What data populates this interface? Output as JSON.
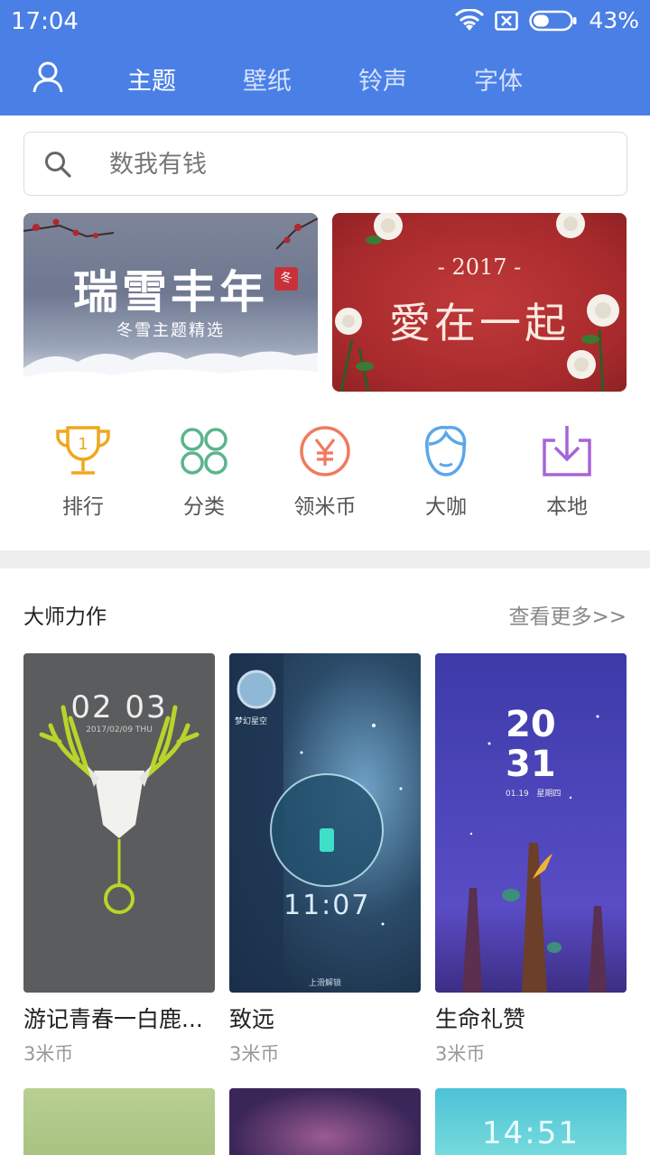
{
  "status_bar": {
    "time": "17:04",
    "battery_percent": "43%",
    "battery_level": 0.43
  },
  "tabs": [
    {
      "label": "主题",
      "active": true
    },
    {
      "label": "壁纸",
      "active": false
    },
    {
      "label": "铃声",
      "active": false
    },
    {
      "label": "字体",
      "active": false
    }
  ],
  "search": {
    "placeholder": "数我有钱"
  },
  "banners": [
    {
      "title": "瑞雪丰年",
      "subtitle": "冬雪主题精选",
      "badge": "冬"
    },
    {
      "year": "- 2017 -",
      "title": "愛在一起"
    }
  ],
  "categories": [
    {
      "label": "排行",
      "icon": "trophy-icon"
    },
    {
      "label": "分类",
      "icon": "grid-circles-icon"
    },
    {
      "label": "领米币",
      "icon": "yen-coin-icon"
    },
    {
      "label": "大咖",
      "icon": "face-icon"
    },
    {
      "label": "本地",
      "icon": "download-tray-icon"
    }
  ],
  "section": {
    "title": "大师力作",
    "more": "查看更多>>"
  },
  "themes": [
    {
      "name": "游记青春一白鹿...",
      "price": "3米币",
      "preview_time": "02 03",
      "preview_date": "2017/02/09  THU"
    },
    {
      "name": "致远",
      "price": "3米币",
      "preview_time": "11:07",
      "preview_label": "梦幻星空",
      "preview_hint": "上滑解锁"
    },
    {
      "name": "生命礼赞",
      "price": "3米币",
      "preview_time_h": "20",
      "preview_time_m": "31",
      "preview_date": "01.19   星期四"
    }
  ],
  "themes_row2": [
    {
      "preview_time": ""
    },
    {
      "preview_time": ""
    },
    {
      "preview_time": "14:51"
    }
  ],
  "colors": {
    "header_blue": "#4a7fe6",
    "trophy": "#f0a71c",
    "grid": "#5bb48c",
    "coin": "#f07a5e",
    "face": "#5aa7e8",
    "download": "#a864d8"
  }
}
